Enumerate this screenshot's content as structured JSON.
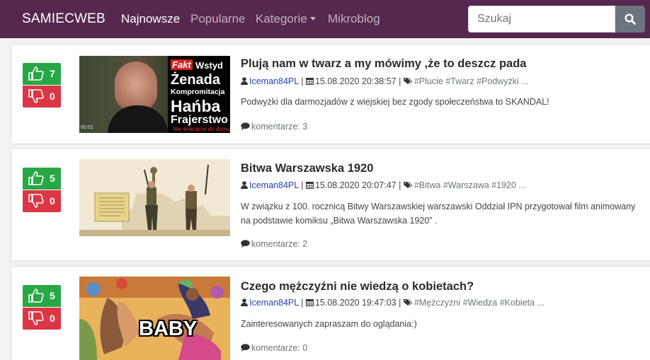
{
  "navbar": {
    "brand": "SAMIECWEB",
    "links": [
      "Najnowsze",
      "Popularne",
      "Kategorie",
      "Mikroblog"
    ],
    "search_placeholder": "Szukaj"
  },
  "colors": {
    "navbar": "#56284f",
    "upvote": "#28a745",
    "downvote": "#dc3545",
    "author": "#2a3fb0"
  },
  "posts": [
    {
      "up": "7",
      "down": "0",
      "title": "Plują nam w twarz a my mówimy ,że to deszcz pada",
      "author": "Iceman84PL",
      "date": "15.08.2020 20:38:57",
      "tags": "#Plucie #Twarz #Podwyżki ...",
      "desc": "Podwyżki dla darmozjadów z wiejskiej bez zgody społeczeństwa to SKANDAL!",
      "comments": "komentarze: 3",
      "thumb_text": [
        "Fakt",
        "Wstyd",
        "Żenada",
        "Kompromitacja",
        "Hańba",
        "Frajerstwo",
        "Nie wracajcie do domu",
        "00:02"
      ]
    },
    {
      "up": "5",
      "down": "0",
      "title": "Bitwa Warszawska 1920",
      "author": "Iceman84PL",
      "date": "15.08.2020 20:07:47",
      "tags": "#Bitwa #Warszawa #1920 ...",
      "desc": "W związku z 100. rocznicą Bitwy Warszawskiej warszawski Oddział IPN przygotował film animowany na podstawie komiksu „Bitwa Warszawska 1920” .",
      "comments": "komentarze: 2"
    },
    {
      "up": "5",
      "down": "0",
      "title": "Czego mężczyźni nie wiedzą o kobietach?",
      "author": "Iceman84PL",
      "date": "15.08.2020 19:47:03",
      "tags": "#Mężczyzni #Wiedza #Kobieta ...",
      "desc": "Zainteresowanych zapraszam do oglądania:)",
      "comments": "komentarze: 0",
      "thumb_text": [
        "BABY"
      ]
    }
  ]
}
